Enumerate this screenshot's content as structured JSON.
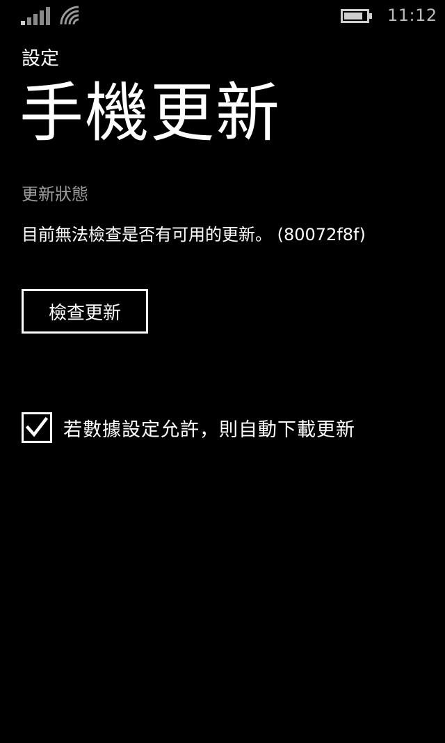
{
  "status_bar": {
    "time": "11:12",
    "icons": [
      "signal-icon",
      "wifi-icon",
      "battery-icon"
    ]
  },
  "header": {
    "app_name": "設定",
    "title": "手機更新"
  },
  "update_status": {
    "label": "更新狀態",
    "message": "目前無法檢查是否有可用的更新。 (80072f8f)"
  },
  "check_button": {
    "label": "檢查更新"
  },
  "auto_download": {
    "checked": true,
    "label": "若數據設定允許，則自動下載更新"
  },
  "colors": {
    "background": "#000000",
    "text": "#ffffff",
    "secondary_text": "#9a9a9a"
  }
}
